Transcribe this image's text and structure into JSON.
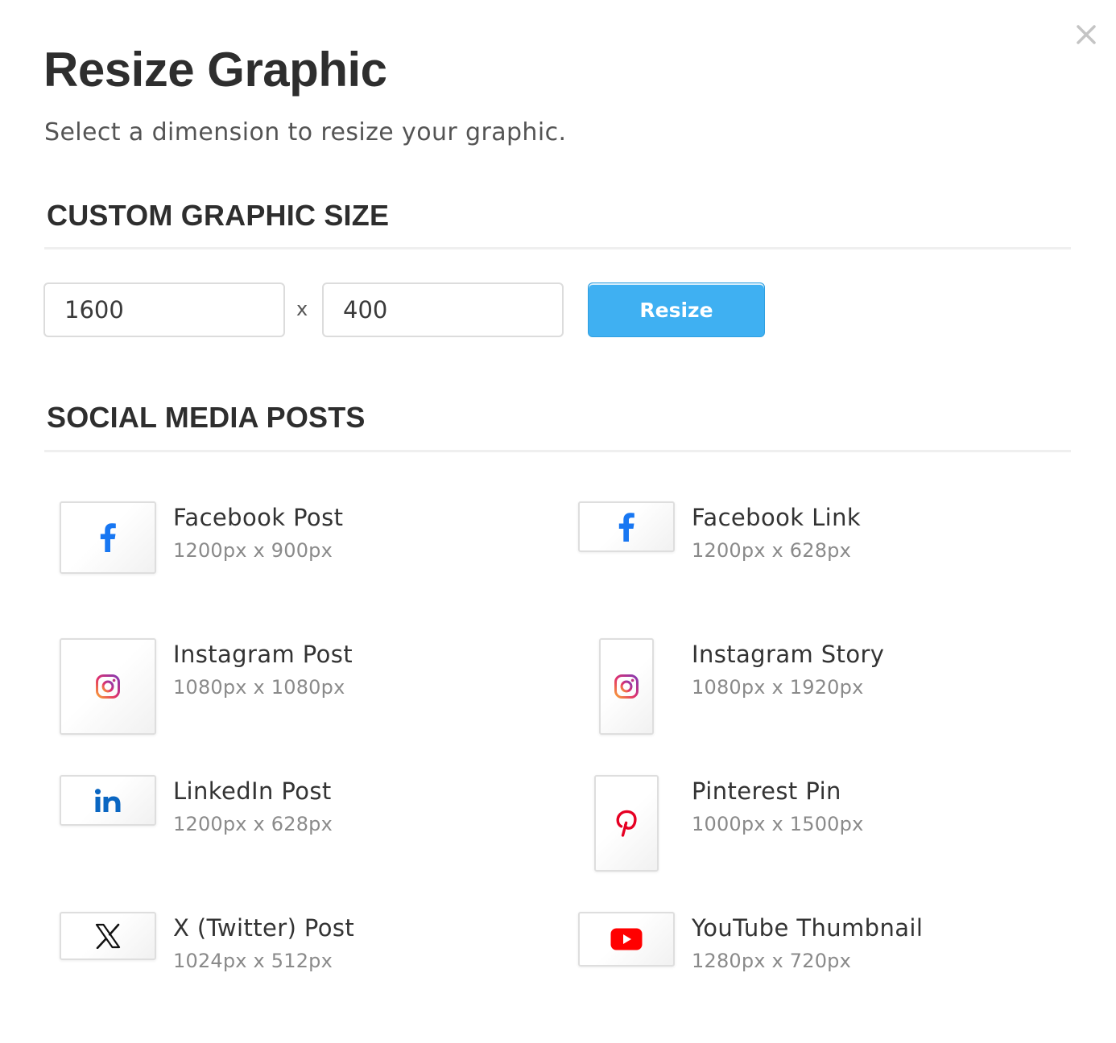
{
  "dialog": {
    "title": "Resize Graphic",
    "subtitle": "Select a dimension to resize your graphic.",
    "close_icon": "close-icon"
  },
  "custom_size": {
    "heading": "CUSTOM GRAPHIC SIZE",
    "width_value": "1600",
    "height_value": "400",
    "separator": "x",
    "resize_label": "Resize",
    "button_color": "#3fb0f2"
  },
  "social": {
    "heading": "SOCIAL MEDIA POSTS",
    "presets": [
      {
        "name": "Facebook Post",
        "size": "1200px x 900px",
        "icon": "facebook-icon",
        "color": "#1877f2"
      },
      {
        "name": "Facebook Link",
        "size": "1200px x 628px",
        "icon": "facebook-icon",
        "color": "#1877f2"
      },
      {
        "name": "Instagram Post",
        "size": "1080px x 1080px",
        "icon": "instagram-icon",
        "color": "#d6249f"
      },
      {
        "name": "Instagram Story",
        "size": "1080px x 1920px",
        "icon": "instagram-icon",
        "color": "#d6249f"
      },
      {
        "name": "LinkedIn Post",
        "size": "1200px x 628px",
        "icon": "linkedin-icon",
        "color": "#0a66c2"
      },
      {
        "name": "Pinterest Pin",
        "size": "1000px x 1500px",
        "icon": "pinterest-icon",
        "color": "#e60023"
      },
      {
        "name": "X (Twitter) Post",
        "size": "1024px x 512px",
        "icon": "x-icon",
        "color": "#111111"
      },
      {
        "name": "YouTube Thumbnail",
        "size": "1280px x 720px",
        "icon": "youtube-icon",
        "color": "#ff0000"
      }
    ]
  }
}
